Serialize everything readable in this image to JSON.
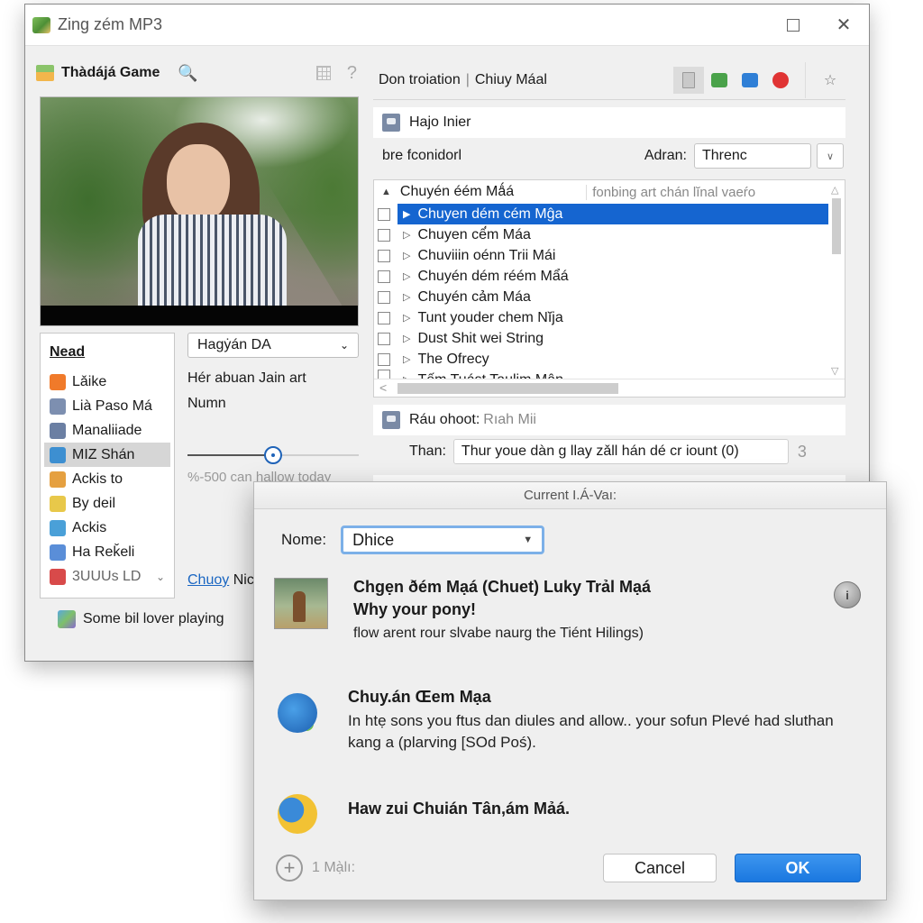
{
  "window": {
    "title": "Zing zém MP3",
    "controls": {
      "maximize_icon": "maximize-icon",
      "close_icon": "close-icon",
      "close_glyph": "✕"
    }
  },
  "left_panel": {
    "header_title": "Thàdájá Game",
    "search_icon": "🔍",
    "help_glyph": "?",
    "photo_alt": "woman-smiling-on-park-path",
    "nav": {
      "heading": "Nead",
      "items": [
        {
          "label": "Lǎike",
          "icon": "basket-icon",
          "color": "#f07a2a"
        },
        {
          "label": "Lià Paso Má",
          "icon": "grid-app-icon",
          "color": "#7d8fb0"
        },
        {
          "label": "Manaliiade",
          "icon": "app-icon",
          "color": "#6b7fa3"
        },
        {
          "label": "MIZ Shán",
          "icon": "gear-app-icon",
          "color": "#3d8fd1",
          "selected": true
        },
        {
          "label": "Ackis to",
          "icon": "image-folder-icon",
          "color": "#e5a040"
        },
        {
          "label": "By deil",
          "icon": "music-note-icon",
          "color": "#e8c84a"
        },
        {
          "label": "Ackis",
          "icon": "chart-app-icon",
          "color": "#4aa0d8"
        },
        {
          "label": "Ha Reǩeli",
          "icon": "globe-app-icon",
          "color": "#5a8ed8"
        },
        {
          "label": "3UUUs LD",
          "icon": "stack-app-icon",
          "color": "#d84a4a",
          "faded": true,
          "has_chevron": true
        }
      ]
    },
    "select_value": "Hagẏán DA",
    "text_line1": "Hér abuan Jain art",
    "text_line2": "Numn",
    "slider": {
      "value_fraction": 0.5
    },
    "slider_caption": "%-500 can hallow today",
    "link_text": "Chuoy",
    "link_suffix": "Nic",
    "status_text": "Some bil lover playing"
  },
  "right_panel": {
    "breadcrumb_part1": "Don troiation",
    "breadcrumb_sep": "|",
    "breadcrumb_part2": "Chiuy Máal",
    "toolbar_icons": [
      {
        "name": "document-icon",
        "color": "#c9c9c9",
        "active": true
      },
      {
        "name": "chart-green-icon",
        "color": "#4aa24a"
      },
      {
        "name": "window-blue-icon",
        "color": "#2f7fd6"
      },
      {
        "name": "red-badge-icon",
        "color": "#e03434"
      }
    ],
    "star_glyph": "☆",
    "group1_title": "Hajo Inier",
    "filter_label": "bre fconidorl",
    "filter_field_label": "Adran:",
    "filter_field_value": "Threnc",
    "list": {
      "col1_header": "Chuyén éém Mǻá",
      "col2_header": "fonbing art chán lĭnal vaeŕo",
      "rows": [
        {
          "label": "Chuyen dém cém Mĝa",
          "selected": true
        },
        {
          "label": "Chuyen cế́m Máa"
        },
        {
          "label": "Chuviiin oénn Trii Mái"
        },
        {
          "label": "Chuyén dém réém Mẩá"
        },
        {
          "label": "Chuyén cảm Máa"
        },
        {
          "label": "Tunt youder chem Nĭja"
        },
        {
          "label": "Dust Shit wei String"
        },
        {
          "label": "The Ofrecy"
        },
        {
          "label": "Tếm Tuást Taulim Mân",
          "clipped": true
        }
      ]
    },
    "group2_title": "Ráu ohoot:",
    "group2_sub": "Rıah Mii",
    "then_label": "Than:",
    "then_value": "Thur youe dàn g llay zǎll hán dé cr iount (0)",
    "then_count": "3"
  },
  "dialog": {
    "title": "Current I.Á-Vaı:",
    "name_label": "Nome:",
    "name_value": "Dhice",
    "items": [
      {
        "title": "Chgẹn ðém Mạá (Chuet) Luky Trảl Mạá",
        "subtitle": "Why your pony!",
        "desc": "flow arent rour slvabe naurg the Tiént Hilings)",
        "icon": "album-art-thumbnail"
      },
      {
        "title": "Chuy.án Œem Mạa",
        "desc": "In htẹ sons you ftus dan diules and allow.. your sofun Plevé had sluthan kang a (plarving [SOd Poś).",
        "icon": "add-blue-icon"
      },
      {
        "title": "Haw zui Chuián Tân,ám Mảá.",
        "icon": "colorful-globe-icon"
      }
    ],
    "info_glyph": "i",
    "add_label": "1 Mạ̀lı:",
    "cancel_label": "Cancel",
    "ok_label": "OK"
  }
}
